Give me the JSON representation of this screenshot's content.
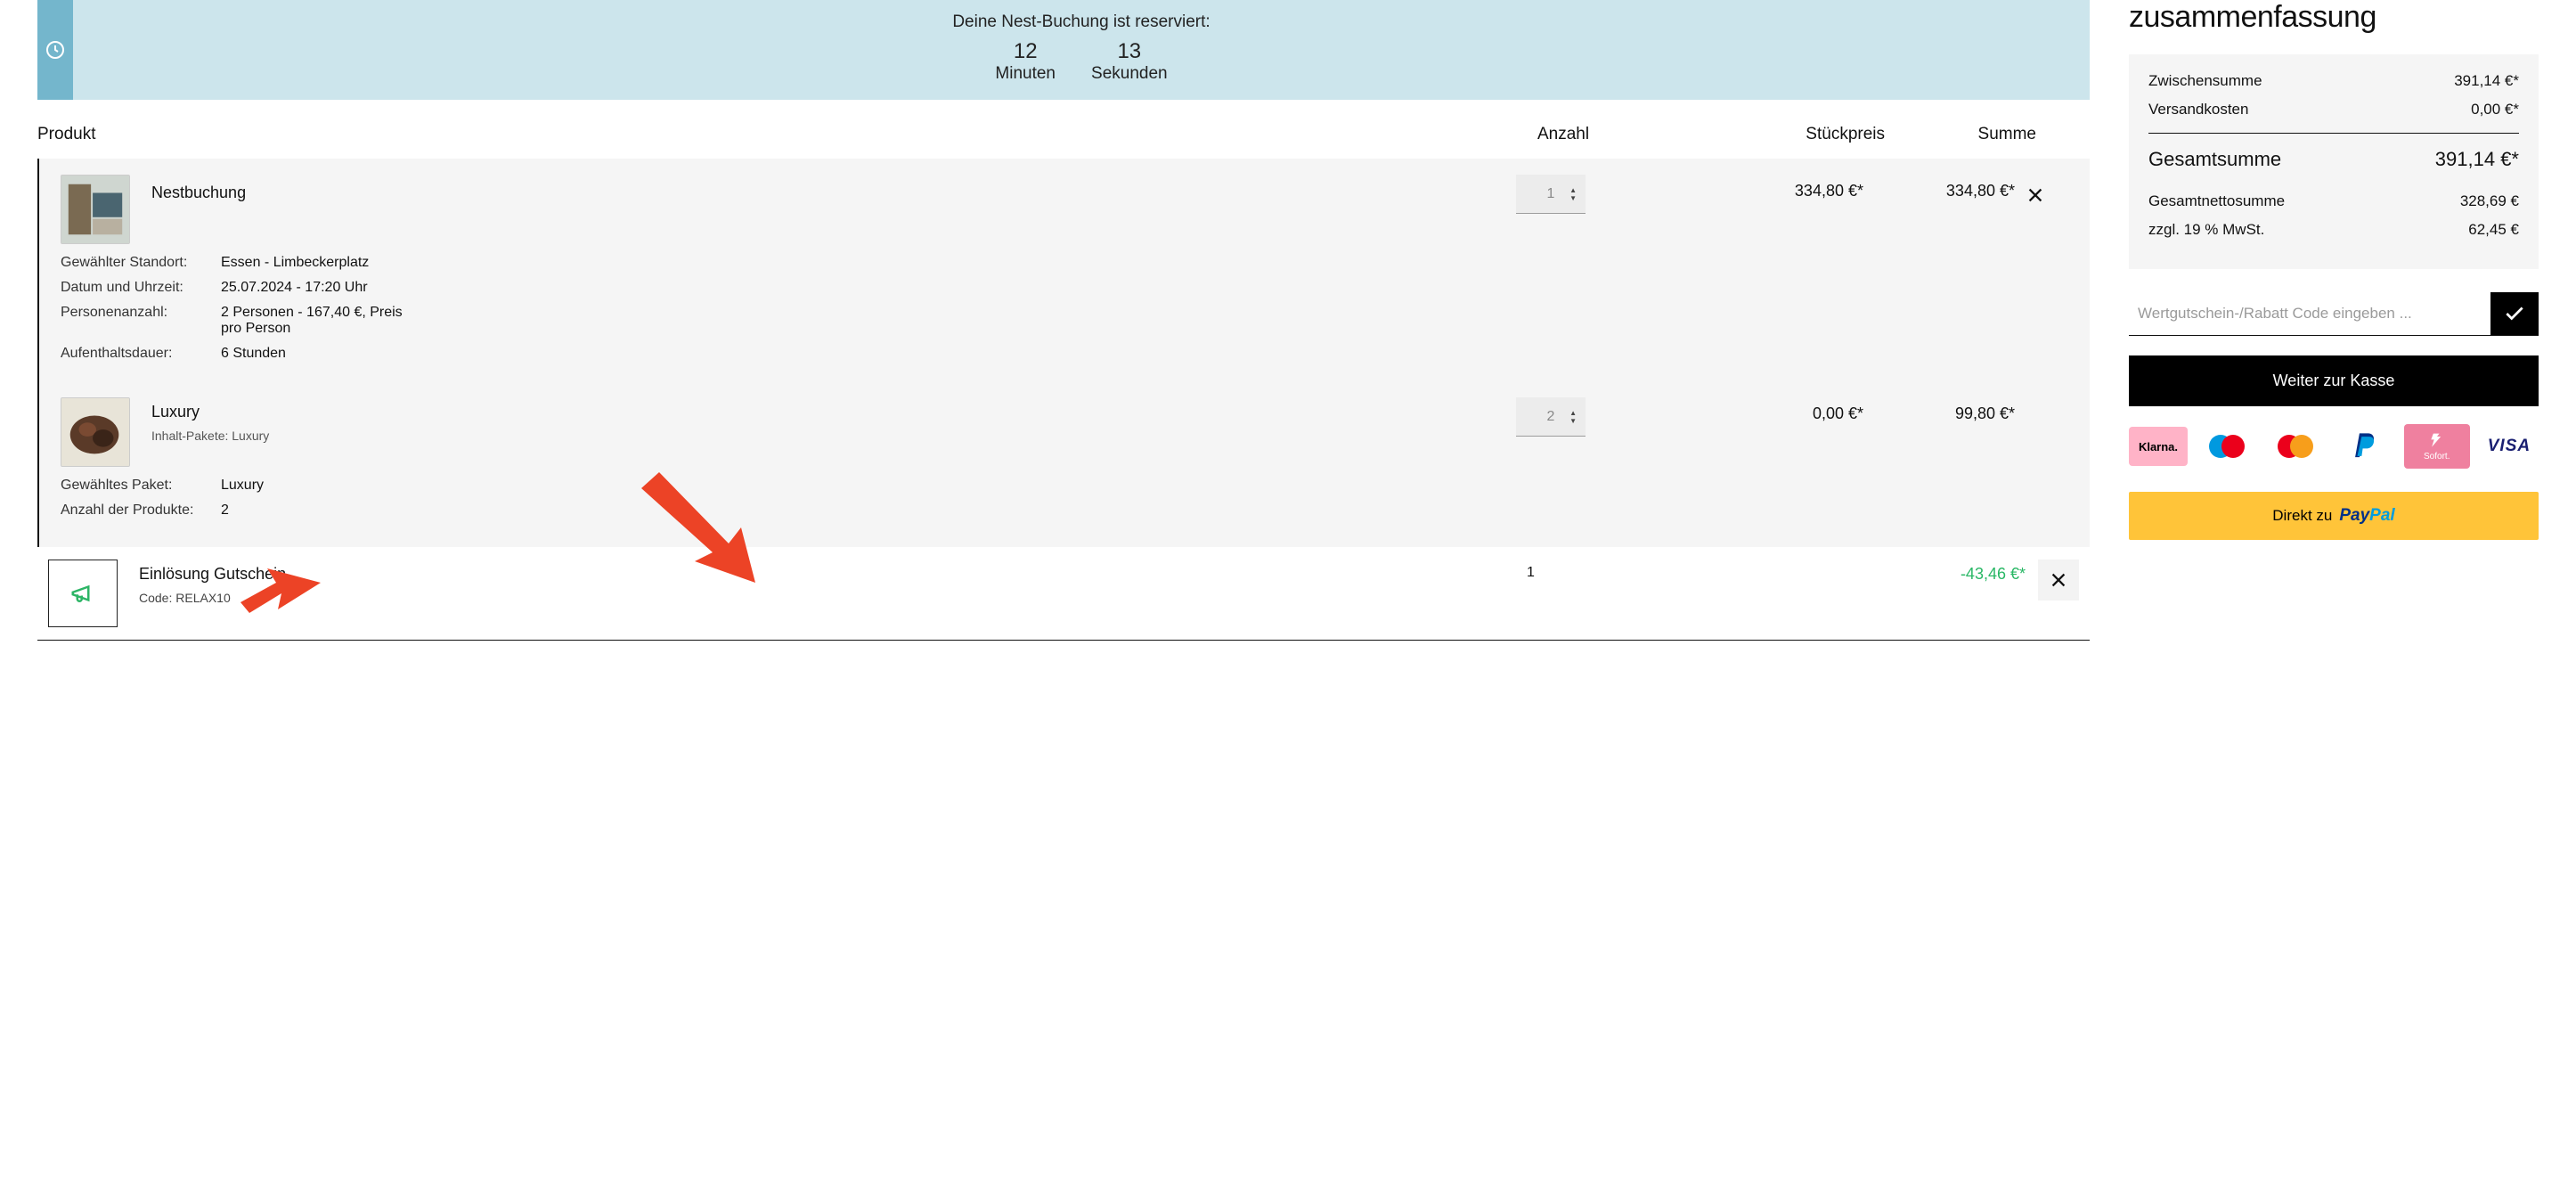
{
  "timer": {
    "title": "Deine Nest-Buchung ist reserviert:",
    "minutes_value": "12",
    "minutes_label": "Minuten",
    "seconds_value": "13",
    "seconds_label": "Sekunden"
  },
  "table": {
    "product": "Produkt",
    "quantity": "Anzahl",
    "unit_price": "Stückpreis",
    "sum": "Summe"
  },
  "items": [
    {
      "name": "Nestbuchung",
      "qty": "1",
      "unit": "334,80 €*",
      "sum": "334,80 €*",
      "details": [
        {
          "label": "Gewählter Standort:",
          "value": "Essen - Limbeckerplatz"
        },
        {
          "label": "Datum und Uhrzeit:",
          "value": "25.07.2024 - 17:20 Uhr"
        },
        {
          "label": "Personenanzahl:",
          "value": "2 Personen - 167,40 €, Preis pro Person"
        },
        {
          "label": "Aufenthaltsdauer:",
          "value": "6 Stunden"
        }
      ]
    },
    {
      "name": "Luxury",
      "sub": "Inhalt-Pakete: Luxury",
      "qty": "2",
      "unit": "0,00 €*",
      "sum": "99,80 €*",
      "details": [
        {
          "label": "Gewähltes Paket:",
          "value": "Luxury"
        },
        {
          "label": "Anzahl der Produkte:",
          "value": "2"
        }
      ]
    }
  ],
  "voucher": {
    "title": "Einlösung Gutschein",
    "code_label": "Code: ",
    "code": "RELAX10",
    "qty": "1",
    "amount": "-43,46 €*"
  },
  "summary": {
    "title": "zusammenfassung",
    "subtotal_label": "Zwischensumme",
    "subtotal_value": "391,14 €*",
    "shipping_label": "Versandkosten",
    "shipping_value": "0,00 €*",
    "total_label": "Gesamtsumme",
    "total_value": "391,14 €*",
    "net_label": "Gesamtnettosumme",
    "net_value": "328,69 €",
    "vat_label": "zzgl. 19 % MwSt.",
    "vat_value": "62,45 €"
  },
  "coupon_placeholder": "Wertgutschein-/Rabatt Code eingeben ...",
  "checkout_label": "Weiter zur Kasse",
  "paypal_prefix": "Direkt zu ",
  "payment_methods": [
    "Klarna",
    "Maestro",
    "Mastercard",
    "PayPal",
    "Sofort",
    "VISA"
  ],
  "colors": {
    "banner": "#cce5ec",
    "banner_accent": "#74b6cc",
    "discount": "#29b765",
    "paypal_btn": "#ffc439"
  }
}
